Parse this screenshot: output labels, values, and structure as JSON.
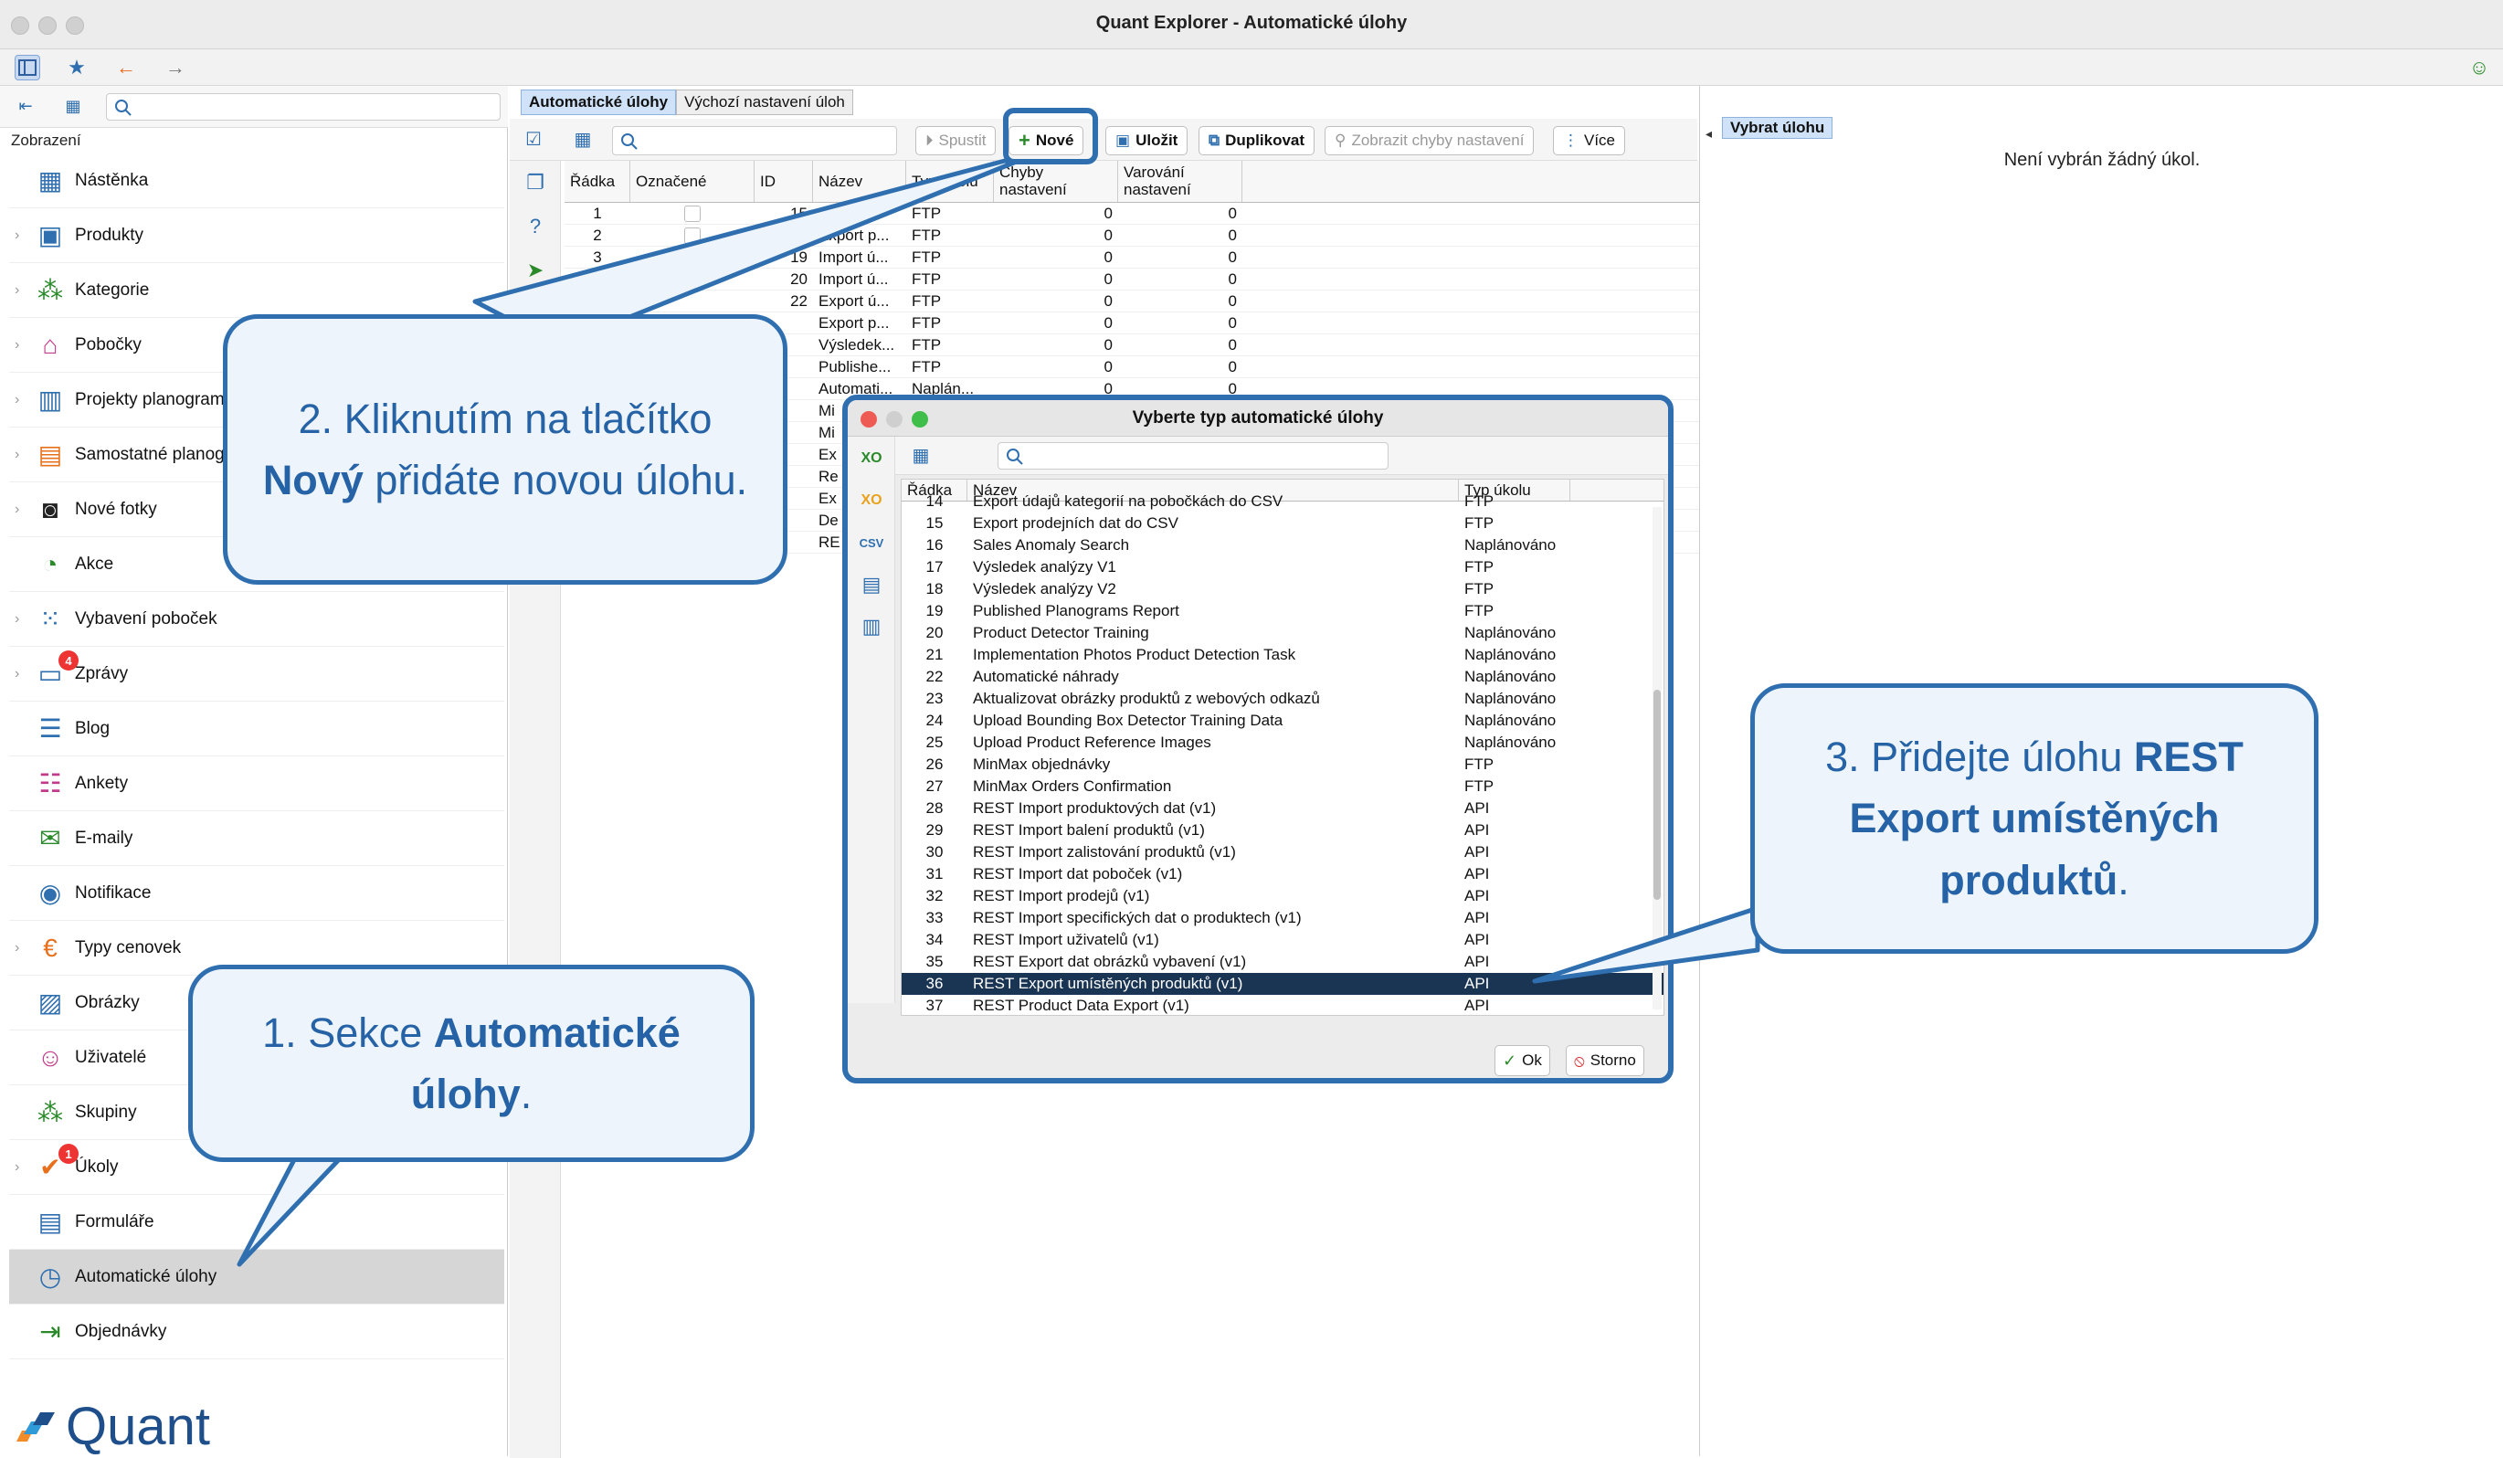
{
  "window": {
    "title": "Quant Explorer - Automatické úlohy"
  },
  "left": {
    "section_label": "Zobrazení",
    "items": [
      {
        "label": "Nástěnka",
        "icon": "dashboard-icon",
        "chev": false
      },
      {
        "label": "Produkty",
        "icon": "product-icon",
        "chev": true
      },
      {
        "label": "Kategorie",
        "icon": "category-icon",
        "chev": true
      },
      {
        "label": "Pobočky",
        "icon": "store-icon",
        "chev": true
      },
      {
        "label": "Projekty planogramů",
        "icon": "planogram-project-icon",
        "chev": true
      },
      {
        "label": "Samostatné planogramy",
        "icon": "planogram-icon",
        "chev": true
      },
      {
        "label": "Nové fotky",
        "icon": "camera-icon",
        "chev": true
      },
      {
        "label": "Akce",
        "icon": "promotion-icon",
        "chev": false
      },
      {
        "label": "Vybavení poboček",
        "icon": "equipment-icon",
        "chev": true
      },
      {
        "label": "Zprávy",
        "icon": "messages-icon",
        "chev": true,
        "badge": "4"
      },
      {
        "label": "Blog",
        "icon": "blog-icon",
        "chev": false
      },
      {
        "label": "Ankety",
        "icon": "survey-icon",
        "chev": false
      },
      {
        "label": "E-maily",
        "icon": "email-icon",
        "chev": false
      },
      {
        "label": "Notifikace",
        "icon": "notification-icon",
        "chev": false
      },
      {
        "label": "Typy cenovek",
        "icon": "price-tag-icon",
        "chev": true
      },
      {
        "label": "Obrázky",
        "icon": "image-icon",
        "chev": false
      },
      {
        "label": "Uživatelé",
        "icon": "user-icon",
        "chev": false
      },
      {
        "label": "Skupiny",
        "icon": "groups-icon",
        "chev": false
      },
      {
        "label": "Úkoly",
        "icon": "tasks-icon",
        "chev": true,
        "badge": "1"
      },
      {
        "label": "Formuláře",
        "icon": "form-icon",
        "chev": false
      },
      {
        "label": "Automatické úlohy",
        "icon": "automation-icon",
        "chev": false,
        "selected": true
      },
      {
        "label": "Objednávky",
        "icon": "orders-icon",
        "chev": false
      }
    ],
    "logo_text": "Quant"
  },
  "mid": {
    "tabs": [
      "Automatické úlohy",
      "Výchozí nastavení úloh"
    ],
    "toolbar": {
      "run": "Spustit",
      "new": "Nové",
      "save": "Uložit",
      "duplicate": "Duplikovat",
      "show_errors": "Zobrazit chyby nastavení",
      "more": "Více"
    },
    "columns": [
      "Řádka",
      "Označené",
      "ID",
      "Název",
      "Typ úkolu",
      "Chyby nastavení",
      "Varování nastavení"
    ],
    "rows": [
      {
        "row": "1",
        "id": "15",
        "name": "Import ...",
        "type": "FTP",
        "err": "0",
        "warn": "0"
      },
      {
        "row": "2",
        "id": "18",
        "name": "Export p...",
        "type": "FTP",
        "err": "0",
        "warn": "0"
      },
      {
        "row": "3",
        "id": "19",
        "name": "Import ú...",
        "type": "FTP",
        "err": "0",
        "warn": "0"
      },
      {
        "row": "4",
        "id": "20",
        "name": "Import ú...",
        "type": "FTP",
        "err": "0",
        "warn": "0"
      },
      {
        "row": "",
        "id": "22",
        "name": "Export ú...",
        "type": "FTP",
        "err": "0",
        "warn": "0"
      },
      {
        "row": "",
        "id": "",
        "name": "Export p...",
        "type": "FTP",
        "err": "0",
        "warn": "0"
      },
      {
        "row": "",
        "id": "",
        "name": "Výsledek...",
        "type": "FTP",
        "err": "0",
        "warn": "0"
      },
      {
        "row": "",
        "id": "",
        "name": "Publishe...",
        "type": "FTP",
        "err": "0",
        "warn": "0"
      },
      {
        "row": "",
        "id": "",
        "name": "Automati...",
        "type": "Naplán...",
        "err": "0",
        "warn": "0"
      },
      {
        "row": "",
        "id": "",
        "name": "Mi",
        "type": "",
        "err": "",
        "warn": ""
      },
      {
        "row": "",
        "id": "",
        "name": "Mi",
        "type": "",
        "err": "",
        "warn": ""
      },
      {
        "row": "",
        "id": "",
        "name": "Ex",
        "type": "",
        "err": "",
        "warn": ""
      },
      {
        "row": "",
        "id": "",
        "name": "Re",
        "type": "",
        "err": "",
        "warn": ""
      },
      {
        "row": "",
        "id": "",
        "name": "Ex",
        "type": "",
        "err": "",
        "warn": ""
      },
      {
        "row": "",
        "id": "",
        "name": "De",
        "type": "",
        "err": "",
        "warn": ""
      },
      {
        "row": "",
        "id": "",
        "name": "RE",
        "type": "",
        "err": "",
        "warn": ""
      }
    ]
  },
  "right": {
    "tab": "Vybrat úlohu",
    "empty": "Není vybrán žádný úkol."
  },
  "dialog": {
    "title": "Vyberte typ automatické úlohy",
    "columns": [
      "Řádka",
      "Název",
      "Typ úkolu"
    ],
    "rows": [
      {
        "row": "14",
        "name": "Export údajů kategorií na pobočkách do CSV",
        "type": "FTP"
      },
      {
        "row": "15",
        "name": "Export prodejních dat do CSV",
        "type": "FTP"
      },
      {
        "row": "16",
        "name": "Sales Anomaly Search",
        "type": "Naplánováno"
      },
      {
        "row": "17",
        "name": "Výsledek analýzy V1",
        "type": "FTP"
      },
      {
        "row": "18",
        "name": "Výsledek analýzy V2",
        "type": "FTP"
      },
      {
        "row": "19",
        "name": "Published Planograms Report",
        "type": "FTP"
      },
      {
        "row": "20",
        "name": "Product Detector Training",
        "type": "Naplánováno"
      },
      {
        "row": "21",
        "name": "Implementation Photos Product Detection Task",
        "type": "Naplánováno"
      },
      {
        "row": "22",
        "name": "Automatické náhrady",
        "type": "Naplánováno"
      },
      {
        "row": "23",
        "name": "Aktualizovat obrázky produktů z webových odkazů",
        "type": "Naplánováno"
      },
      {
        "row": "24",
        "name": "Upload Bounding Box Detector Training Data",
        "type": "Naplánováno"
      },
      {
        "row": "25",
        "name": "Upload Product Reference Images",
        "type": "Naplánováno"
      },
      {
        "row": "26",
        "name": "MinMax objednávky",
        "type": "FTP"
      },
      {
        "row": "27",
        "name": "MinMax Orders Confirmation",
        "type": "FTP"
      },
      {
        "row": "28",
        "name": "REST Import produktových dat (v1)",
        "type": "API"
      },
      {
        "row": "29",
        "name": "REST Import balení produktů (v1)",
        "type": "API"
      },
      {
        "row": "30",
        "name": "REST Import zalistování produktů (v1)",
        "type": "API"
      },
      {
        "row": "31",
        "name": "REST Import dat poboček (v1)",
        "type": "API"
      },
      {
        "row": "32",
        "name": "REST Import prodejů (v1)",
        "type": "API"
      },
      {
        "row": "33",
        "name": "REST Import specifických dat o produktech (v1)",
        "type": "API"
      },
      {
        "row": "34",
        "name": "REST Import uživatelů (v1)",
        "type": "API"
      },
      {
        "row": "35",
        "name": "REST Export dat obrázků vybavení (v1)",
        "type": "API"
      },
      {
        "row": "36",
        "name": "REST Export umístěných produktů (v1)",
        "type": "API",
        "selected": true
      },
      {
        "row": "37",
        "name": "REST Product Data Export (v1)",
        "type": "API"
      }
    ],
    "ok": "Ok",
    "cancel": "Storno"
  },
  "callouts": {
    "c1_pre": "1. Sekce ",
    "c1_bold": "Automatické úlohy",
    "c1_post": ".",
    "c2_pre": "2. Kliknutím na tlačítko ",
    "c2_bold": "Nový",
    "c2_post": " přidáte novou úlohu.",
    "c3_pre": "3. Přidejte úlohu ",
    "c3_bold": "REST Export umístěných produktů",
    "c3_post": "."
  },
  "colors": {
    "accent": "#2f6fb0",
    "selected_row": "#1a3454",
    "callout_text": "#2563a6"
  }
}
